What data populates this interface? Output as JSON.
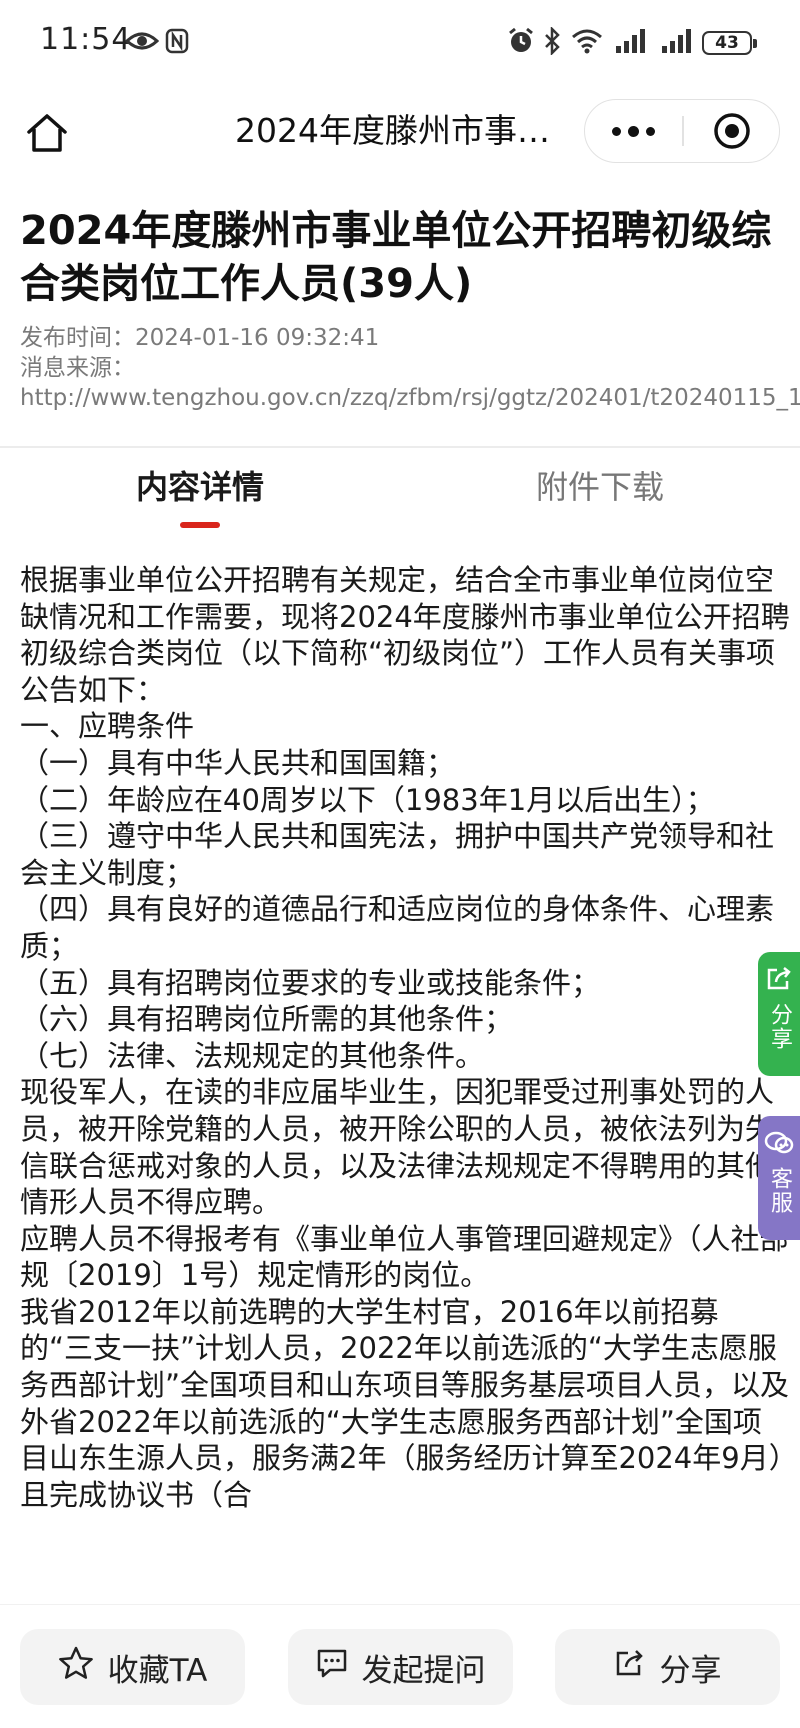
{
  "status_bar": {
    "time": "11:54",
    "battery": "43",
    "icons": [
      "eye-icon",
      "nfc-icon",
      "alarm-icon",
      "bluetooth-icon",
      "wifi-icon",
      "signal-icon",
      "signal-icon",
      "battery-icon"
    ]
  },
  "nav": {
    "title": "2024年度滕州市事…",
    "icons": [
      "home-icon",
      "more-icon",
      "close-target-icon"
    ]
  },
  "article": {
    "title": "2024年度滕州市事业单位公开招聘初级综合类岗位工作人员(39人)",
    "publish_time": "发布时间：2024-01-16 09:32:41",
    "source_label": "消息来源：",
    "source_url": "http://www.tengzhou.gov.cn/zzq/zfbm/rsj/ggtz/202401/t20240115_1"
  },
  "tabs": [
    {
      "label": "内容详情",
      "active": true
    },
    {
      "label": "附件下载",
      "active": false
    }
  ],
  "content": {
    "paragraphs": [
      "根据事业单位公开招聘有关规定，结合全市事业单位岗位空缺情况和工作需要，现将2024年度滕州市事业单位公开招聘初级综合类岗位（以下简称“初级岗位”）工作人员有关事项公告如下：",
      "一、应聘条件",
      "（一）具有中华人民共和国国籍；",
      "（二）年龄应在40周岁以下（1983年1月以后出生）；",
      "（三）遵守中华人民共和国宪法，拥护中国共产党领导和社会主义制度；",
      "（四）具有良好的道德品行和适应岗位的身体条件、心理素质；",
      "（五）具有招聘岗位要求的专业或技能条件；",
      "（六）具有招聘岗位所需的其他条件；",
      "（七）法律、法规规定的其他条件。",
      "现役军人，在读的非应届毕业生，因犯罪受过刑事处罚的人员，被开除党籍的人员，被开除公职的人员，被依法列为失信联合惩戒对象的人员，以及法律法规规定不得聘用的其他情形人员不得应聘。",
      "应聘人员不得报考有《事业单位人事管理回避规定》（人社部规〔2019〕1号）规定情形的岗位。",
      "我省2012年以前选聘的大学生村官，2016年以前招募的“三支一扶”计划人员，2022年以前选派的“大学生志愿服务西部计划”全国项目和山东项目等服务基层项目人员，以及外省2022年以前选派的“大学生志愿服务西部计划”全国项目山东生源人员，服务满2年（服务经历计算至2024年9月）且完成协议书（合"
    ]
  },
  "float": {
    "share_label": "分享",
    "service_label": "客服",
    "icons": [
      "share-icon",
      "chat-service-icon"
    ]
  },
  "bottom_bar": {
    "favorite_label": "收藏TA",
    "ask_label": "发起提问",
    "share_label": "分享",
    "icons": [
      "star-icon",
      "message-icon",
      "share-icon"
    ]
  },
  "colors": {
    "accent": "#d9261c",
    "share_float": "#34b24f",
    "service_float": "#8576c6"
  }
}
